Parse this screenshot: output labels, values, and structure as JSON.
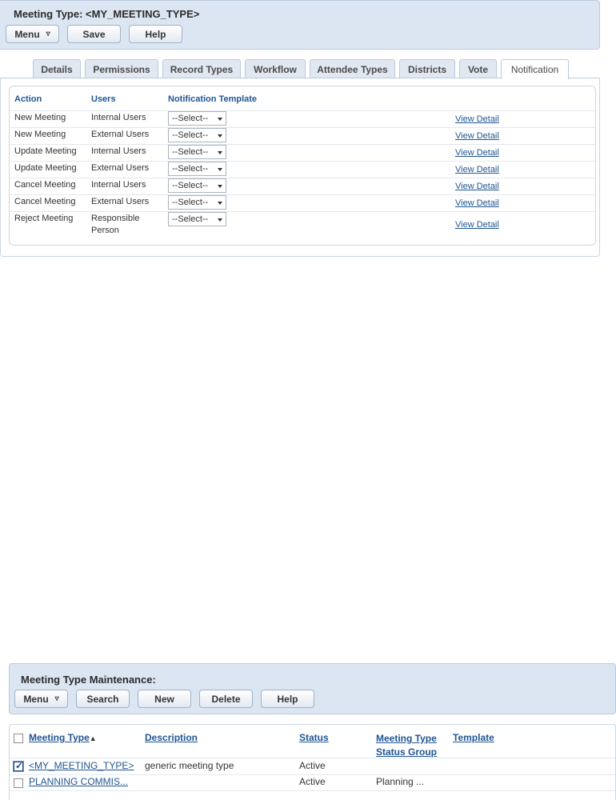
{
  "header": {
    "title": "Meeting Type: <MY_MEETING_TYPE>",
    "menu_label": "Menu",
    "save_label": "Save",
    "help_label": "Help"
  },
  "tabs": [
    {
      "label": "Details"
    },
    {
      "label": "Permissions"
    },
    {
      "label": "Record Types"
    },
    {
      "label": "Workflow"
    },
    {
      "label": "Attendee Types"
    },
    {
      "label": "Districts"
    },
    {
      "label": "Vote"
    },
    {
      "label": "Notification",
      "active": true
    }
  ],
  "notifications": {
    "columns": {
      "action": "Action",
      "users": "Users",
      "template": "Notification Template"
    },
    "rows": [
      {
        "action": "New Meeting",
        "users": "Internal Users",
        "template": "--Select--",
        "link": "View Detail"
      },
      {
        "action": "New Meeting",
        "users": "External Users",
        "template": "--Select--",
        "link": "View Detail"
      },
      {
        "action": "Update Meeting",
        "users": "Internal Users",
        "template": "--Select--",
        "link": "View Detail"
      },
      {
        "action": "Update Meeting",
        "users": "External Users",
        "template": "--Select--",
        "link": "View Detail"
      },
      {
        "action": "Cancel Meeting",
        "users": "Internal Users",
        "template": "--Select--",
        "link": "View Detail"
      },
      {
        "action": "Cancel Meeting",
        "users": "External Users",
        "template": "--Select--",
        "link": "View Detail"
      },
      {
        "action": "Reject Meeting",
        "users": "Responsible Person",
        "users_line1": "Responsible",
        "users_line2": "Person",
        "template": "--Select--",
        "link": "View Detail"
      }
    ]
  },
  "maintenance": {
    "title": "Meeting Type Maintenance:",
    "buttons": {
      "menu": "Menu",
      "search": "Search",
      "new": "New",
      "delete": "Delete",
      "help": "Help"
    },
    "columns": {
      "meeting_type": "Meeting Type",
      "sort_indicator": "▲",
      "description": "Description",
      "status": "Status",
      "status_group_line1": "Meeting Type",
      "status_group_line2": "Status Group",
      "template": "Template"
    },
    "rows": [
      {
        "meeting_type": "<MY_MEETING_TYPE>",
        "description": "generic meeting type",
        "status": "Active",
        "status_group": "",
        "checked": true
      },
      {
        "meeting_type": "PLANNING COMMIS...",
        "description": "",
        "status": "Active",
        "status_group": "Planning ...",
        "checked": false
      }
    ]
  },
  "colors": {
    "panel_bg": "#dce6f2",
    "link": "#1f5591",
    "border": "#b8cadf"
  }
}
